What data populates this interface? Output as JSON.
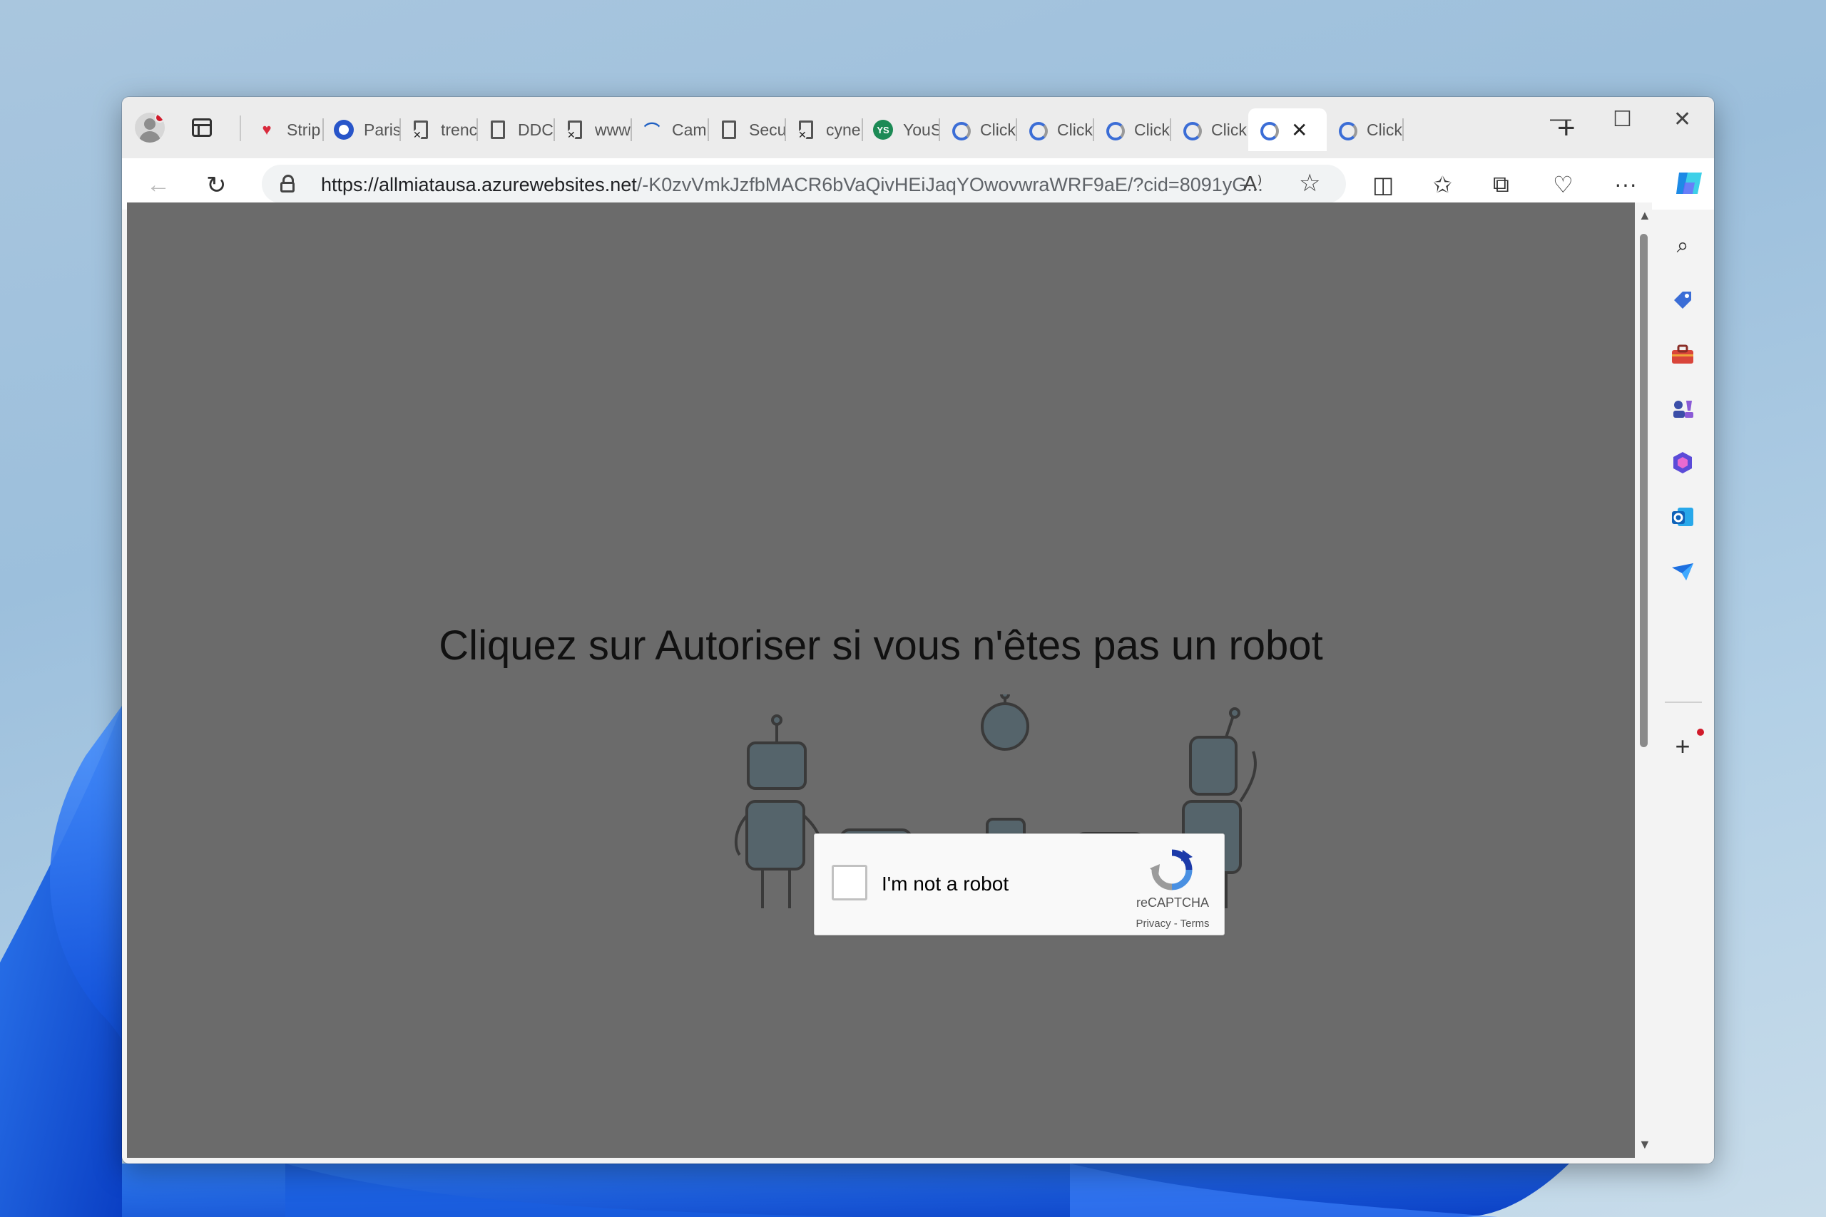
{
  "browser": {
    "tabs": [
      {
        "title": "Strip",
        "icon": "heart-icon"
      },
      {
        "title": "Paris",
        "icon": "eye-icon"
      },
      {
        "title": "trenc",
        "icon": "blocked-doc-icon"
      },
      {
        "title": "DDC",
        "icon": "doc-icon"
      },
      {
        "title": "www",
        "icon": "blocked-doc-icon"
      },
      {
        "title": "Cam",
        "icon": "cam-icon"
      },
      {
        "title": "Secu",
        "icon": "doc-icon"
      },
      {
        "title": "cyne",
        "icon": "blocked-doc-icon"
      },
      {
        "title": "YouS",
        "icon": "ys-icon",
        "badge": "YS"
      },
      {
        "title": "Click",
        "icon": "recaptcha-icon"
      },
      {
        "title": "Click",
        "icon": "recaptcha-icon"
      },
      {
        "title": "Click",
        "icon": "recaptcha-icon"
      },
      {
        "title": "Click",
        "icon": "recaptcha-icon"
      },
      {
        "title": "",
        "icon": "recaptcha-icon",
        "active": true
      },
      {
        "title": "Click",
        "icon": "recaptcha-icon"
      }
    ],
    "url_host": "https://allmiatausa.azurewebsites.net",
    "url_path": "/-K0zvVmkJzfbMACR6bVaQivHEiJaqYOwovwraWRF9aE/?cid=8091yG...",
    "read_aloud_label": "A⁾",
    "colors": {
      "page_bg": "#6b6b6b",
      "accent": "#3b6dd6"
    }
  },
  "page": {
    "headline": "Cliquez sur Autoriser si vous n'êtes pas un robot",
    "captcha": {
      "label": "I'm not a robot",
      "brand": "reCAPTCHA",
      "links": "Privacy - Terms",
      "checked": false
    }
  }
}
